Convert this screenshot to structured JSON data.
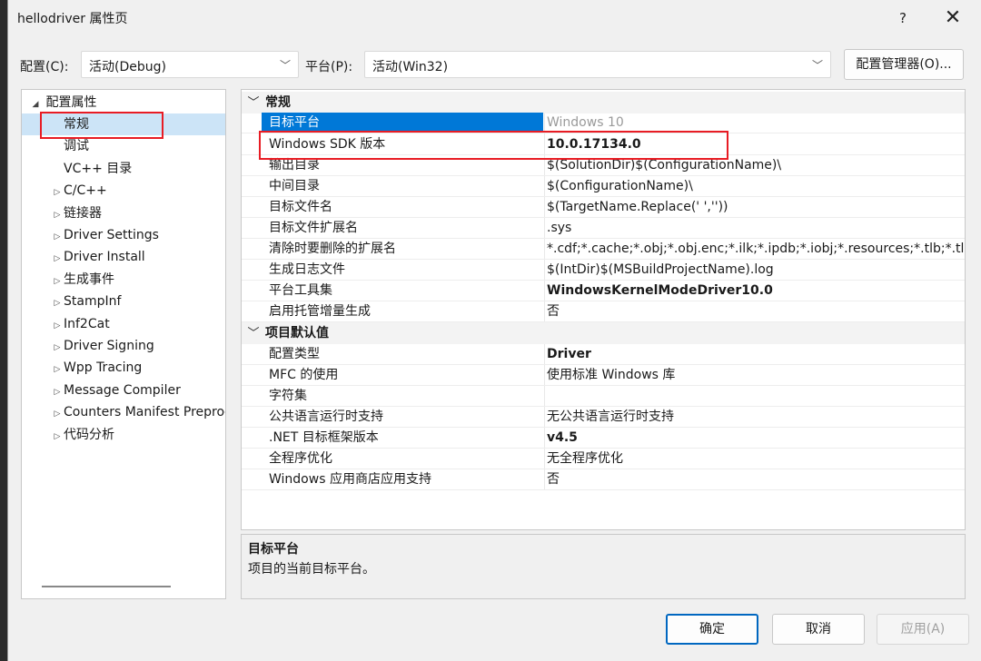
{
  "window": {
    "title": "hellodriver 属性页",
    "help_label": "?",
    "close_label": "✕"
  },
  "toolbar": {
    "config_label": "配置(C):",
    "config_value": "活动(Debug)",
    "platform_label": "平台(P):",
    "platform_value": "活动(Win32)",
    "config_manager_label": "配置管理器(O)...",
    "dropdown_arrow": "﹀"
  },
  "tree": {
    "root": "配置属性",
    "items": [
      {
        "label": "常规",
        "expandable": false,
        "selected": true
      },
      {
        "label": "调试",
        "expandable": false
      },
      {
        "label": "VC++ 目录",
        "expandable": false
      },
      {
        "label": "C/C++",
        "expandable": true
      },
      {
        "label": "链接器",
        "expandable": true
      },
      {
        "label": "Driver Settings",
        "expandable": true
      },
      {
        "label": "Driver Install",
        "expandable": true
      },
      {
        "label": "生成事件",
        "expandable": true
      },
      {
        "label": "StampInf",
        "expandable": true
      },
      {
        "label": "Inf2Cat",
        "expandable": true
      },
      {
        "label": "Driver Signing",
        "expandable": true
      },
      {
        "label": "Wpp Tracing",
        "expandable": true
      },
      {
        "label": "Message Compiler",
        "expandable": true
      },
      {
        "label": "Counters Manifest Preprocessor",
        "expandable": true
      },
      {
        "label": "代码分析",
        "expandable": true
      }
    ]
  },
  "grid": {
    "categories": [
      {
        "name": "常规",
        "rows": [
          {
            "name": "目标平台",
            "value": "Windows 10",
            "selected": true,
            "style": "gray"
          },
          {
            "name": "Windows SDK 版本",
            "value": "10.0.17134.0",
            "style": "bold"
          },
          {
            "name": "输出目录",
            "value": "$(SolutionDir)$(ConfigurationName)\\"
          },
          {
            "name": "中间目录",
            "value": "$(ConfigurationName)\\"
          },
          {
            "name": "目标文件名",
            "value": "$(TargetName.Replace(' ',''))"
          },
          {
            "name": "目标文件扩展名",
            "value": ".sys"
          },
          {
            "name": "清除时要删除的扩展名",
            "value": "*.cdf;*.cache;*.obj;*.obj.enc;*.ilk;*.ipdb;*.iobj;*.resources;*.tlb;*.tli;*.t"
          },
          {
            "name": "生成日志文件",
            "value": "$(IntDir)$(MSBuildProjectName).log"
          },
          {
            "name": "平台工具集",
            "value": "WindowsKernelModeDriver10.0",
            "style": "bold"
          },
          {
            "name": "启用托管增量生成",
            "value": "否"
          }
        ]
      },
      {
        "name": "项目默认值",
        "rows": [
          {
            "name": "配置类型",
            "value": "Driver",
            "style": "bold"
          },
          {
            "name": "MFC 的使用",
            "value": "使用标准 Windows 库"
          },
          {
            "name": "字符集",
            "value": ""
          },
          {
            "name": "公共语言运行时支持",
            "value": "无公共语言运行时支持"
          },
          {
            "name": ".NET 目标框架版本",
            "value": "v4.5",
            "style": "bold"
          },
          {
            "name": "全程序优化",
            "value": "无全程序优化"
          },
          {
            "name": "Windows 应用商店应用支持",
            "value": "否"
          }
        ]
      }
    ]
  },
  "description": {
    "title": "目标平台",
    "body": "项目的当前目标平台。"
  },
  "buttons": {
    "ok": "确定",
    "cancel": "取消",
    "apply": "应用(A)"
  },
  "colors": {
    "selection": "#0078d7",
    "tree_selection": "#cce4f7",
    "highlight_box": "#e81c24"
  }
}
